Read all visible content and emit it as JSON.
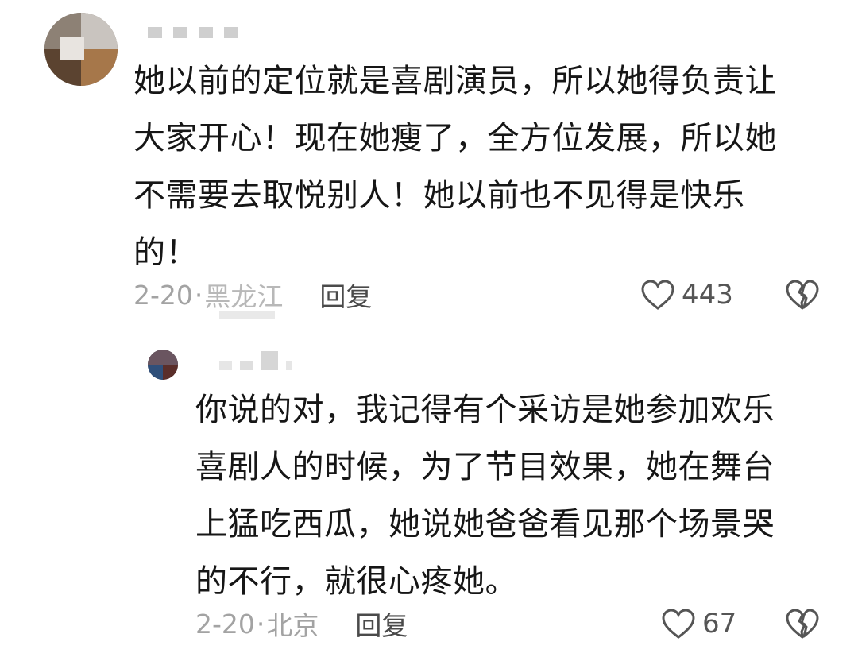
{
  "comments": [
    {
      "text": "她以前的定位就是喜剧演员，所以她得负责让\n大家开心！现在她瘦了，全方位发展，所以她\n不需要去取悦别人！她以前也不见得是快乐\n的！",
      "date": "2-20",
      "dot": "·",
      "location": "黑龙江",
      "reply_label": "回复",
      "likes": "443"
    },
    {
      "text": "你说的对，我记得有个采访是她参加欢乐\n喜剧人的时候，为了节目效果，她在舞台\n上猛吃西瓜，她说她爸爸看见那个场景哭\n的不行，就很心疼她。",
      "date": "2-20",
      "dot": "·",
      "location": "北京",
      "reply_label": "回复",
      "likes": "67"
    }
  ],
  "icons": {
    "like": "heart-outline-icon",
    "dislike": "broken-heart-icon"
  },
  "colors": {
    "text": "#161616",
    "meta": "#a3a3a3",
    "icon": "#555555"
  }
}
